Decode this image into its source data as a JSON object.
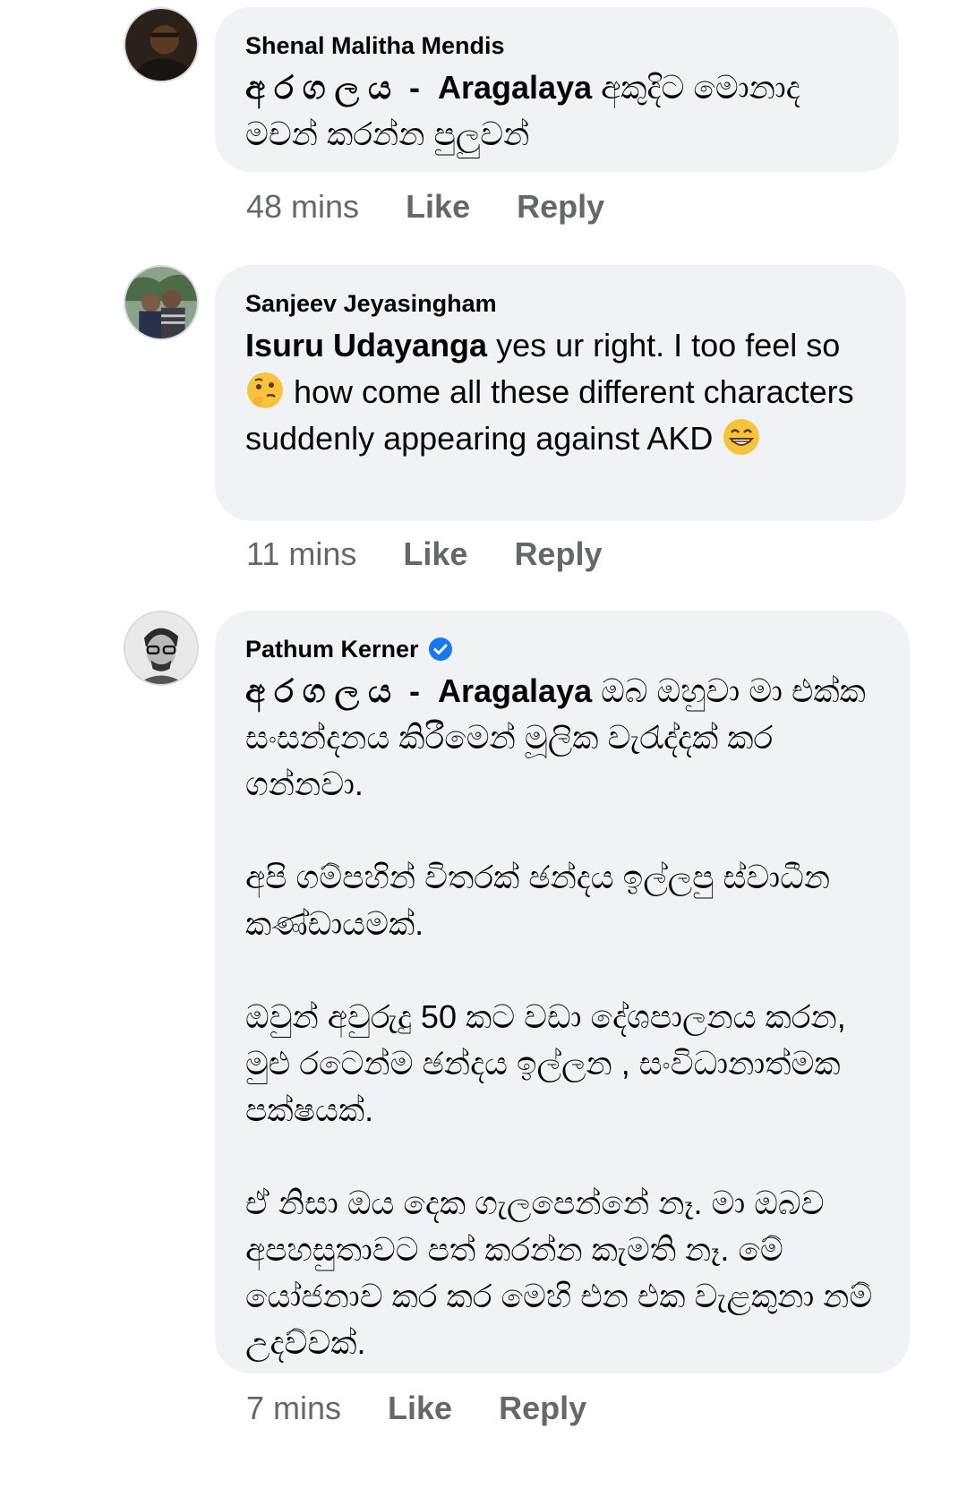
{
  "comments": [
    {
      "author": "Shenal Malitha Mendis",
      "verified": false,
      "mention": "අ ර ග ල ය  -  Aragalaya",
      "text": " අකුදිට මොනාද මචන් කරන්න පුලුවන්",
      "time": "48 mins",
      "like": "Like",
      "reply": "Reply"
    },
    {
      "author": "Sanjeev Jeyasingham",
      "verified": false,
      "mention": "Isuru Udayanga",
      "text_before_emoji": " yes ur right. I too feel so ",
      "emoji1": "thinking-face",
      "text_after_emoji": " how come all these different characters  suddenly appearing against AKD ",
      "emoji2": "grinning-face",
      "time": "11 mins",
      "like": "Like",
      "reply": "Reply"
    },
    {
      "author": "Pathum Kerner",
      "verified": true,
      "mention": "අ ර ග ල ය  -  Aragalaya",
      "text": " ඔබ ඔහුවා මා එක්ක සංසන්දනය කිරීමෙන් මූලික වැරැද්දක් කර ගන්නවා.\n\nඅපි ගම්පහින් විතරක් ඡන්දය ඉල්ලපු ස්වාධීන කණ්ඩායමක්.\n\nඔවුන් අවුරුදු 50 කට වඩා දේශපාලනය කරන, මුළු රටෙන්ම ඡන්දය ඉල්ලන , සංවිධානාත්මක පක්ෂයක්.\n\nඒ නිසා ඔය දෙක ගැලපෙන්නේ නෑ. මා ඔබව අපහසුතාවට පත් කරන්න කැමති නෑ. මේ යෝජනාව කර කර මෙහි එන එක වැළකුනා නම් උදව්වක්.",
      "time": "7 mins",
      "like": "Like",
      "reply": "Reply"
    }
  ],
  "colors": {
    "bubble": "#f0f2f5",
    "meta": "#65676b",
    "verified": "#1877f2"
  }
}
